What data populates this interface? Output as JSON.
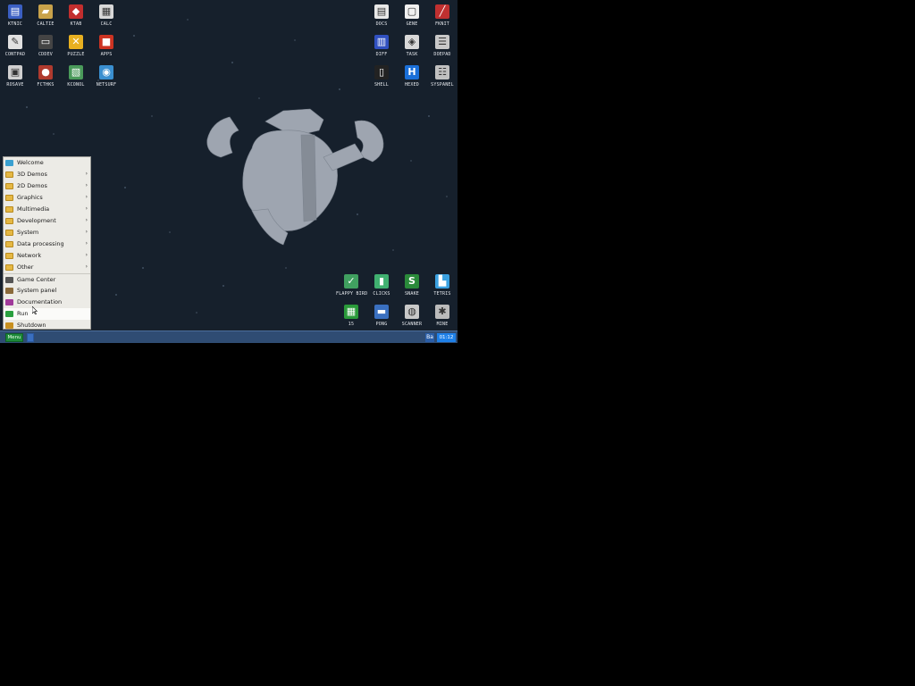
{
  "desktop": {
    "icons_left": [
      {
        "label": "KTNIC",
        "icon": "notepad-icon",
        "color": "#3b5fc2"
      },
      {
        "label": "CALTIE",
        "icon": "folder-icon",
        "color": "#c8a24a"
      },
      {
        "label": "KTAB",
        "icon": "game-icon",
        "color": "#c22e2e"
      },
      {
        "label": "CALC",
        "icon": "calculator-icon",
        "color": "#d8d8d8"
      },
      {
        "label": "CONTPAD",
        "icon": "editor-icon",
        "color": "#e0e0e0"
      },
      {
        "label": "CDDEV",
        "icon": "tape-icon",
        "color": "#444444"
      },
      {
        "label": "PUZZLE",
        "icon": "cross-icon",
        "color": "#e8b020"
      },
      {
        "label": "APPS",
        "icon": "cube-icon",
        "color": "#cc3322"
      },
      {
        "label": "ROSAVE",
        "icon": "printer-icon",
        "color": "#d0d0d0"
      },
      {
        "label": "FCTHKS",
        "icon": "shell-icon",
        "color": "#b03a2e"
      },
      {
        "label": "KCONOL",
        "icon": "image-viewer-icon",
        "color": "#4a9a5a"
      },
      {
        "label": "NETSURF",
        "icon": "globe-icon",
        "color": "#3a8fd0"
      }
    ],
    "icons_top_right": [
      {
        "label": "DOCS",
        "icon": "document-icon",
        "color": "#e8e8e8"
      },
      {
        "label": "GENE",
        "icon": "window-icon",
        "color": "#f0f0f0"
      },
      {
        "label": "FKNIT",
        "icon": "screwdriver-icon",
        "color": "#c03030"
      },
      {
        "label": "DIFF",
        "icon": "diff-icon",
        "color": "#3050c0"
      },
      {
        "label": "TASK",
        "icon": "task-icon",
        "color": "#d8d8d8"
      },
      {
        "label": "DOEPAD",
        "icon": "list-icon",
        "color": "#c8c8c8"
      },
      {
        "label": "SHELL",
        "icon": "terminal-icon",
        "color": "#222222"
      },
      {
        "label": "HEXED",
        "icon": "hex-icon",
        "color": "#1a6fd8"
      },
      {
        "label": "SYSPANEL",
        "icon": "panel-icon",
        "color": "#c0c0c0"
      }
    ],
    "icons_bottom_right": [
      {
        "label": "FLAPPY BIRD",
        "icon": "bird-icon",
        "color": "#40a060"
      },
      {
        "label": "CLICKS",
        "icon": "bars-icon",
        "color": "#40b070"
      },
      {
        "label": "SNAKE",
        "icon": "snake-icon",
        "color": "#2a8a3a"
      },
      {
        "label": "TETRIS",
        "icon": "blocks-icon",
        "color": "#3aa0e0"
      },
      {
        "label": "15",
        "icon": "grid-icon",
        "color": "#2a9a3a"
      },
      {
        "label": "PONG",
        "icon": "paddle-icon",
        "color": "#3a70c0"
      },
      {
        "label": "SCANNER",
        "icon": "scanner-icon",
        "color": "#c8c8c8"
      },
      {
        "label": "MINE",
        "icon": "mine-icon",
        "color": "#bbbbbb"
      }
    ]
  },
  "menu": {
    "items": [
      {
        "label": "Welcome",
        "icon": "welcome-icon",
        "submenu": false
      },
      {
        "label": "3D Demos",
        "icon": "folder-icon",
        "submenu": true
      },
      {
        "label": "2D Demos",
        "icon": "folder-icon",
        "submenu": true
      },
      {
        "label": "Graphics",
        "icon": "folder-icon",
        "submenu": true
      },
      {
        "label": "Multimedia",
        "icon": "folder-icon",
        "submenu": true
      },
      {
        "label": "Development",
        "icon": "folder-icon",
        "submenu": true
      },
      {
        "label": "System",
        "icon": "folder-icon",
        "submenu": true
      },
      {
        "label": "Data processing",
        "icon": "folder-icon",
        "submenu": true
      },
      {
        "label": "Network",
        "icon": "folder-icon",
        "submenu": true
      },
      {
        "label": "Other",
        "icon": "folder-icon",
        "submenu": true
      },
      {
        "label": "Game Center",
        "icon": "game-center-icon",
        "submenu": false
      },
      {
        "label": "System panel",
        "icon": "system-panel-icon",
        "submenu": false
      },
      {
        "label": "Documentation",
        "icon": "book-icon",
        "submenu": false
      },
      {
        "label": "Run",
        "icon": "run-icon",
        "submenu": false
      },
      {
        "label": "Shutdown",
        "icon": "shutdown-icon",
        "submenu": false
      }
    ],
    "arrow": "›"
  },
  "taskbar": {
    "start_label": "Menu",
    "tray_sound": "Ba",
    "clock": "01:12"
  }
}
